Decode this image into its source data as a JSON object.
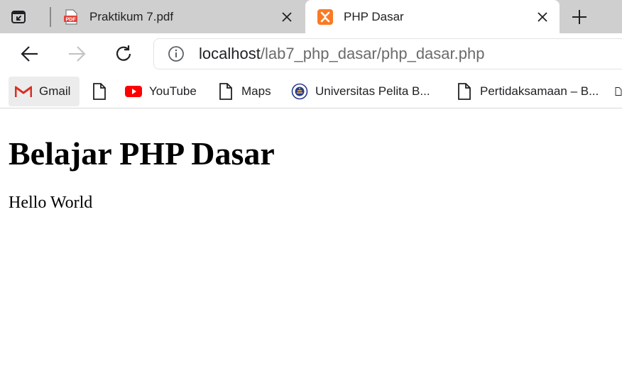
{
  "tabs": [
    {
      "title": "Praktikum 7.pdf",
      "favicon": "pdf-icon",
      "active": false
    },
    {
      "title": "PHP Dasar",
      "favicon": "xampp-icon",
      "active": true
    }
  ],
  "pdf_favicon_text": "PDF",
  "address": {
    "host": "localhost",
    "path": "/lab7_php_dasar/php_dasar.php"
  },
  "bookmarks": [
    {
      "label": "Gmail",
      "icon": "gmail-icon"
    },
    {
      "label": "",
      "icon": "page-icon"
    },
    {
      "label": "YouTube",
      "icon": "youtube-icon"
    },
    {
      "label": "Maps",
      "icon": "page-icon"
    },
    {
      "label": "Universitas Pelita B...",
      "icon": "university-icon"
    },
    {
      "label": "Pertidaksamaan – B...",
      "icon": "page-icon"
    }
  ],
  "page": {
    "heading": "Belajar PHP Dasar",
    "text": "Hello World"
  },
  "colors": {
    "tabstrip": "#cfcfcf",
    "xampp_orange": "#fb7a24",
    "pdf_red": "#e2453c",
    "youtube_red": "#ff0000"
  }
}
